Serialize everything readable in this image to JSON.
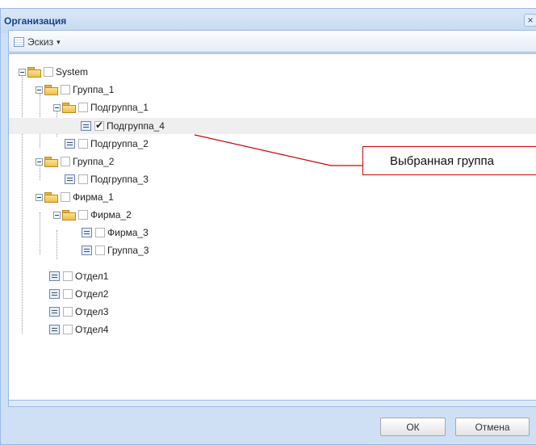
{
  "window": {
    "title": "Организация",
    "close_glyph": "×"
  },
  "toolbar": {
    "view_label": "Эскиз",
    "view_icon": "sketch-icon",
    "caret_glyph": "▾"
  },
  "tree": {
    "root": "System",
    "group_1": "Группа_1",
    "subgroup_1": "Подгруппа_1",
    "subgroup_4": "Подгруппа_4",
    "subgroup_2": "Подгруппа_2",
    "group_2": "Группа_2",
    "subgroup_3": "Подгруппа_3",
    "firm_1": "Фирма_1",
    "firm_2": "Фирма_2",
    "firm_3": "Фирма_3",
    "group_3": "Группа_3",
    "dept_1": "Отдел1",
    "dept_2": "Отдел2",
    "dept_3": "Отдел3",
    "dept_4": "Отдел4",
    "checked_item": "Подгруппа_4"
  },
  "callout": {
    "text": "Выбранная группа",
    "color": "#d40000"
  },
  "buttons": {
    "ok": "ОК",
    "cancel": "Отмена"
  },
  "colors": {
    "window_bg": "#cfe0f4",
    "border": "#99bbe8",
    "title_text": "#15428b",
    "selected_row": "#efefef"
  }
}
